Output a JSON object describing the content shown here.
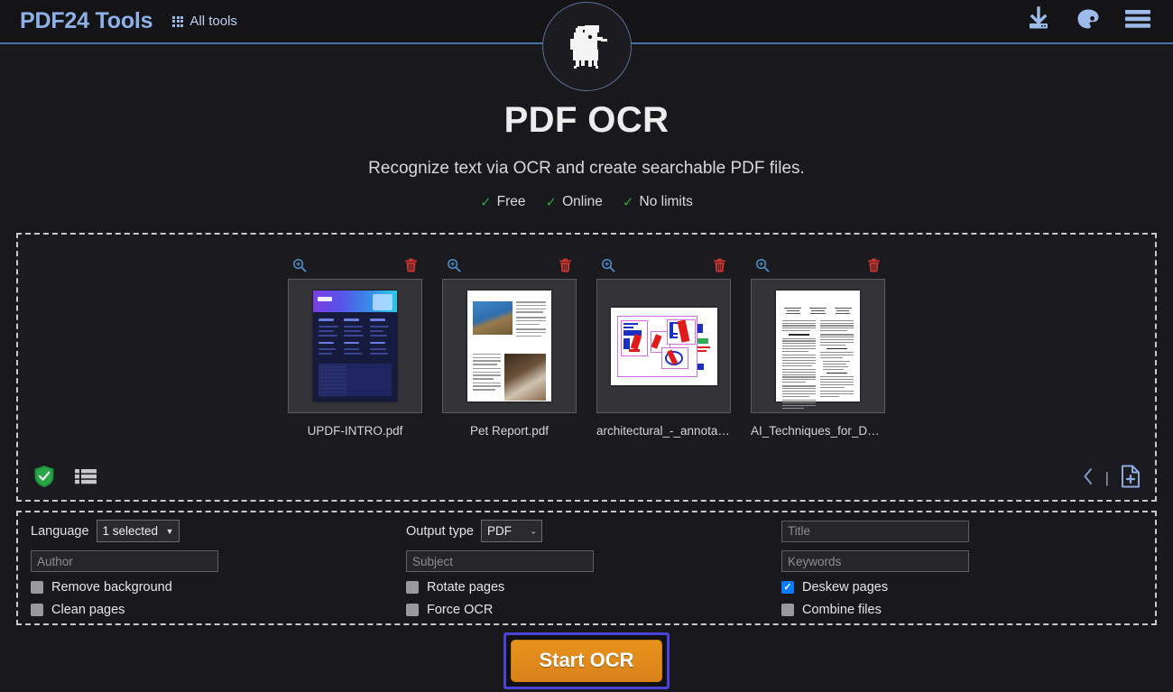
{
  "header": {
    "brand": "PDF24 Tools",
    "all_tools_label": "All tools",
    "icons": {
      "grid": "grid-icon",
      "download": "download-icon",
      "theme": "palette-icon",
      "menu": "hamburger-menu-icon"
    },
    "accent_color": "#8eb1e8",
    "border_color": "#4a6fa5"
  },
  "logo": {
    "alt": "pdf24-logo"
  },
  "hero": {
    "title": "PDF OCR",
    "subtitle": "Recognize text via OCR and create searchable PDF files.",
    "features": [
      {
        "check": "✓",
        "label": "Free"
      },
      {
        "check": "✓",
        "label": "Online"
      },
      {
        "check": "✓",
        "label": "No limits"
      }
    ],
    "check_color": "#35a03c"
  },
  "dropzone": {
    "files": [
      {
        "name": "UPDF-INTRO.pdf",
        "zoom_icon": "zoom-in-icon",
        "delete_icon": "trash-icon"
      },
      {
        "name": "Pet Report.pdf",
        "zoom_icon": "zoom-in-icon",
        "delete_icon": "trash-icon"
      },
      {
        "name": "architectural_-_annotati...",
        "zoom_icon": "zoom-in-icon",
        "delete_icon": "trash-icon"
      },
      {
        "name": "AI_Techniques_for_Dete...",
        "zoom_icon": "zoom-in-icon",
        "delete_icon": "trash-icon"
      }
    ],
    "toolbar": {
      "shield_icon": "shield-check-icon",
      "list_icon": "list-view-icon",
      "prev_icon": "chevron-left-icon",
      "divider": "|",
      "add_file_icon": "add-file-icon"
    }
  },
  "options": {
    "language_label": "Language",
    "language_value": "1 selected",
    "language_options": [
      "1 selected"
    ],
    "output_type_label": "Output type",
    "output_type_value": "PDF",
    "output_type_options": [
      "PDF"
    ],
    "title_placeholder": "Title",
    "title_value": "",
    "author_placeholder": "Author",
    "author_value": "",
    "subject_placeholder": "Subject",
    "subject_value": "",
    "keywords_placeholder": "Keywords",
    "keywords_value": "",
    "checkboxes": [
      {
        "label": "Remove background",
        "checked": false
      },
      {
        "label": "Rotate pages",
        "checked": false
      },
      {
        "label": "Deskew pages",
        "checked": true
      },
      {
        "label": "Clean pages",
        "checked": false
      },
      {
        "label": "Force OCR",
        "checked": false
      },
      {
        "label": "Combine files",
        "checked": false
      }
    ],
    "checked_color": "#0a7cff"
  },
  "action": {
    "start_label": "Start OCR",
    "button_color": "#e0891c",
    "focus_ring_color": "#4a44d8"
  }
}
